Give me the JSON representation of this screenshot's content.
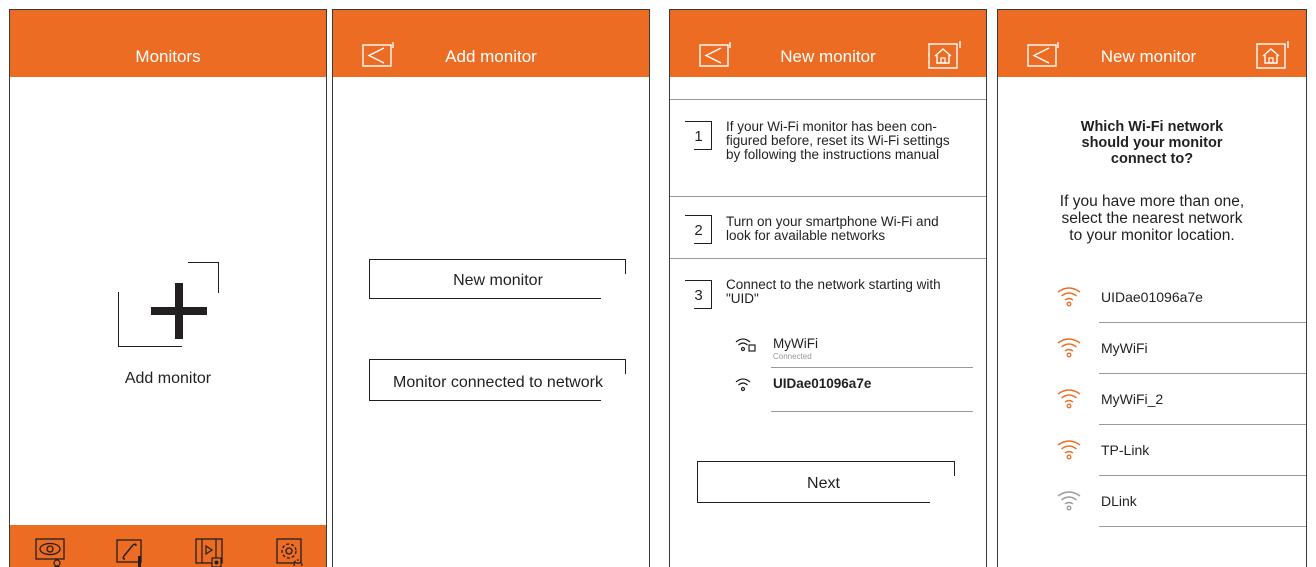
{
  "colors": {
    "accent": "#ec6c24",
    "text": "#231f20",
    "line": "#9a9a9a"
  },
  "screen1": {
    "title": "Monitors",
    "add_label": "Add monitor",
    "nav_icons": [
      "camera-view-icon",
      "call-log-icon",
      "media-gallery-icon",
      "settings-icon"
    ]
  },
  "screen2": {
    "title": "Add monitor",
    "options": [
      "New monitor",
      "Monitor connected to network"
    ]
  },
  "screen3": {
    "title": "New monitor",
    "steps": [
      {
        "num": "1",
        "text": "If your Wi-Fi monitor has been con-\nfigured before, reset its Wi-Fi settings\nby following the instructions manual"
      },
      {
        "num": "2",
        "text": "Turn on your smartphone Wi-Fi and\nlook for available networks"
      },
      {
        "num": "3",
        "text": "Connect to the network starting with\n\"UID\""
      }
    ],
    "networks": [
      {
        "name": "MyWiFi",
        "status": "Connected"
      },
      {
        "name": "UIDae01096a7e"
      }
    ],
    "next_label": "Next"
  },
  "screen4": {
    "title": "New monitor",
    "question": "Which Wi-Fi network\nshould your monitor\nconnect to?",
    "hint": "If you have more than one,\nselect the nearest network\nto your monitor location.",
    "networks": [
      {
        "name": "UIDae01096a7e",
        "color": "#ec6c24"
      },
      {
        "name": "MyWiFi",
        "color": "#ec6c24"
      },
      {
        "name": "MyWiFi_2",
        "color": "#ec6c24"
      },
      {
        "name": "TP-Link",
        "color": "#ec6c24"
      },
      {
        "name": "DLink",
        "color": "#9a9a9a"
      }
    ]
  }
}
